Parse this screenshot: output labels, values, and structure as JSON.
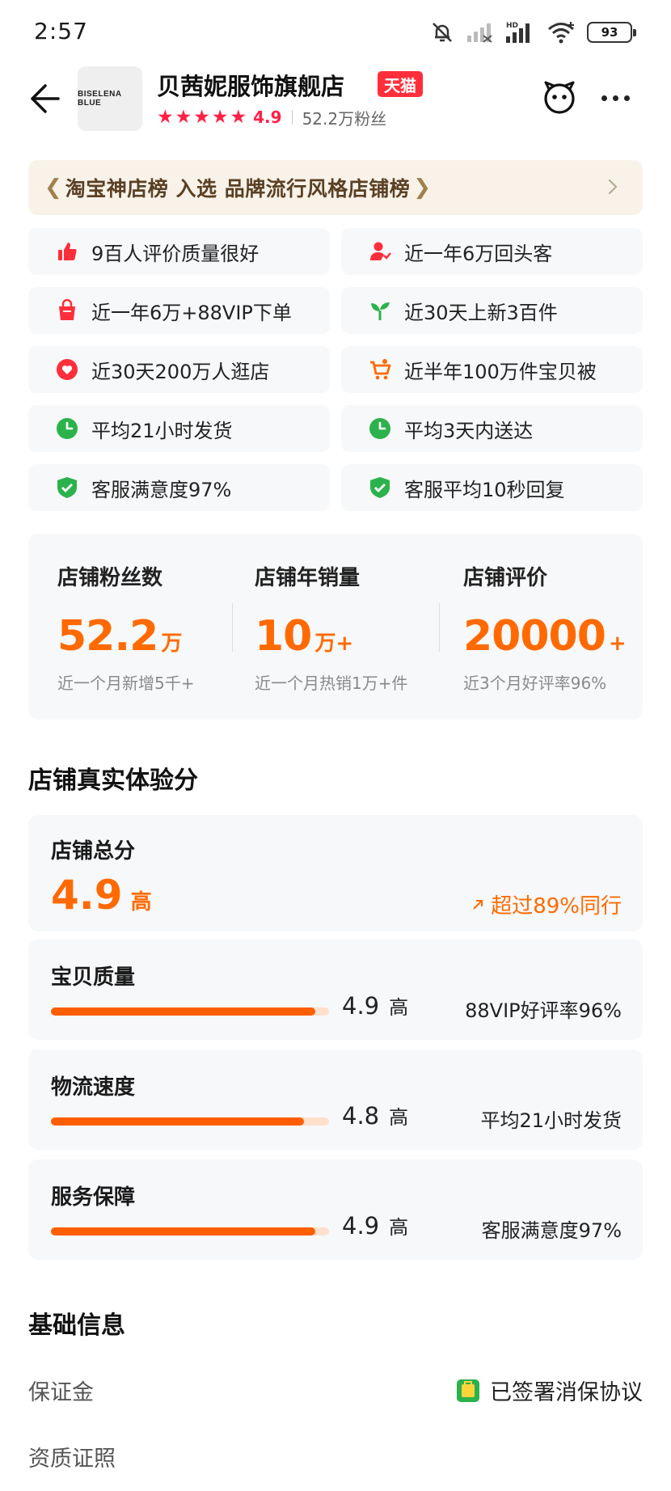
{
  "status_bar": {
    "time": "2:57",
    "battery": "93",
    "network": "HD"
  },
  "header": {
    "logo_text": "BISELENA BLUE",
    "store_name": "贝茜妮服饰旗舰店",
    "badge": "天猫",
    "rating": "4.9",
    "star_count": 5,
    "fans": "52.2万粉丝"
  },
  "banner": {
    "text": "淘宝神店榜 入选 品牌流行风格店铺榜"
  },
  "features": [
    {
      "icon": "thumbs-up-icon",
      "color": "#ff2e3b",
      "text": "9百人评价质量很好"
    },
    {
      "icon": "user-repeat-icon",
      "color": "#ff2e3b",
      "text": "近一年6万回头客"
    },
    {
      "icon": "shopping-bag-icon",
      "color": "#ff2e3b",
      "text": "近一年6万+88VIP下单"
    },
    {
      "icon": "sprout-icon",
      "color": "#2bb24c",
      "text": "近30天上新3百件"
    },
    {
      "icon": "heart-icon",
      "color": "#ff2e3b",
      "text": "近30天200万人逛店"
    },
    {
      "icon": "cart-icon",
      "color": "#ff6a00",
      "text": "近半年100万件宝贝被"
    },
    {
      "icon": "clock-icon",
      "color": "#2bb24c",
      "text": "平均21小时发货"
    },
    {
      "icon": "clock-icon",
      "color": "#2bb24c",
      "text": "平均3天内送达"
    },
    {
      "icon": "shield-check-icon",
      "color": "#2bb24c",
      "text": "客服满意度97%"
    },
    {
      "icon": "shield-check-icon",
      "color": "#2bb24c",
      "text": "客服平均10秒回复"
    }
  ],
  "stats": [
    {
      "label": "店铺粉丝数",
      "value": "52.2",
      "unit": "万",
      "sub": "近一个月新增5千+"
    },
    {
      "label": "店铺年销量",
      "value": "10",
      "unit": "万+",
      "sub": "近一个月热销1万+件"
    },
    {
      "label": "店铺评价",
      "value": "20000",
      "unit": "+",
      "sub": "近3个月好评率96%"
    }
  ],
  "experience": {
    "title": "店铺真实体验分",
    "total": {
      "label": "店铺总分",
      "score": "4.9",
      "level": "高",
      "exceed": "超过89%同行"
    },
    "items": [
      {
        "label": "宝贝质量",
        "score": "4.9",
        "level": "高",
        "fill": 0.95,
        "desc": "88VIP好评率96%"
      },
      {
        "label": "物流速度",
        "score": "4.8",
        "level": "高",
        "fill": 0.91,
        "desc": "平均21小时发货"
      },
      {
        "label": "服务保障",
        "score": "4.9",
        "level": "高",
        "fill": 0.95,
        "desc": "客服满意度97%"
      }
    ]
  },
  "basic_info": {
    "title": "基础信息",
    "deposit_label": "保证金",
    "deposit_value": "已签署消保协议",
    "qualification_label": "资质证照"
  },
  "colors": {
    "accent": "#ff6a00",
    "tmall_red": "#ff2e3b",
    "green": "#2bb24c"
  }
}
